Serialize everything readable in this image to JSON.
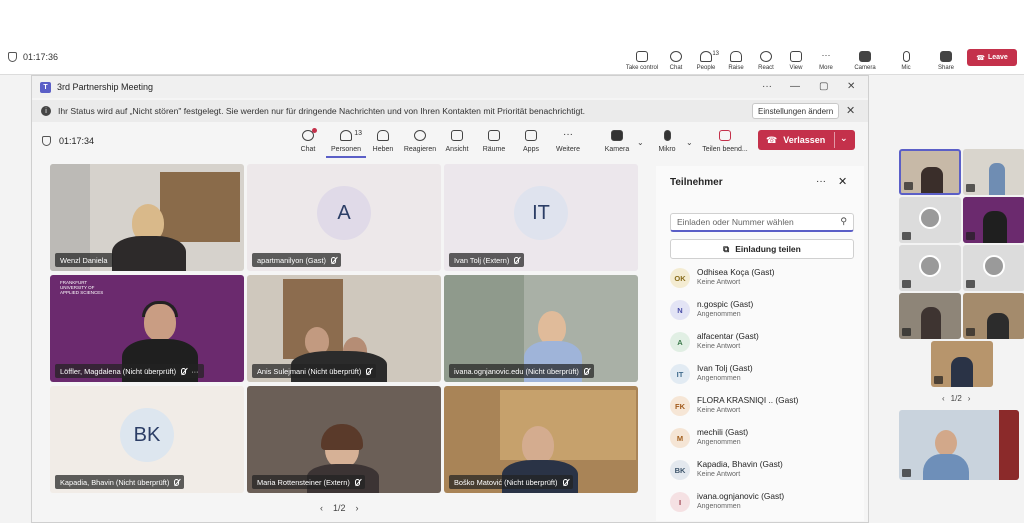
{
  "outer": {
    "timer": "01:17:36",
    "tools": [
      {
        "label": "Take control",
        "icon": "take-control-icon"
      },
      {
        "label": "Chat",
        "icon": "chat-icon"
      },
      {
        "label": "People",
        "icon": "people-icon",
        "count": "13"
      },
      {
        "label": "Raise",
        "icon": "raise-hand-icon"
      },
      {
        "label": "React",
        "icon": "react-icon"
      },
      {
        "label": "View",
        "icon": "view-icon"
      },
      {
        "label": "More",
        "icon": "more-icon"
      },
      {
        "label": "Camera",
        "icon": "camera-icon"
      },
      {
        "label": "Mic",
        "icon": "mic-icon"
      },
      {
        "label": "Share",
        "icon": "share-icon"
      }
    ],
    "leave_label": "Leave"
  },
  "window": {
    "title": "3rd Partnership Meeting",
    "more": "···",
    "minimize": "—",
    "maximize": "▢",
    "close": "✕"
  },
  "banner": {
    "message": "Ihr Status wird auf „Nicht stören\" festgelegt. Sie werden nur für dringende Nachrichten und von Ihren Kontakten mit Priorität benachrichtigt.",
    "settings_label": "Einstellungen ändern",
    "close": "✕"
  },
  "toolbar": {
    "timer": "01:17:34",
    "tools": [
      {
        "label": "Chat",
        "icon": "chat-icon"
      },
      {
        "label": "Personen",
        "icon": "people-icon",
        "count": "13"
      },
      {
        "label": "Heben",
        "icon": "raise-hand-icon"
      },
      {
        "label": "Reagieren",
        "icon": "react-icon"
      },
      {
        "label": "Ansicht",
        "icon": "view-icon"
      },
      {
        "label": "Räume",
        "icon": "rooms-icon"
      },
      {
        "label": "Apps",
        "icon": "apps-icon"
      },
      {
        "label": "Weitere",
        "icon": "more-icon"
      },
      {
        "label": "Kamera",
        "icon": "camera-icon"
      },
      {
        "label": "Mikro",
        "icon": "mic-icon"
      },
      {
        "label": "Teilen beend...",
        "icon": "stop-share-icon"
      }
    ],
    "leave_label": "Verlassen"
  },
  "tiles": [
    {
      "name": "Wenzl Daniela",
      "type": "video"
    },
    {
      "name": "apartmanilyon (Gast)",
      "type": "avatar",
      "initials": "A",
      "bg": "#ede8ea"
    },
    {
      "name": "Ivan Tolj (Extern)",
      "type": "avatar",
      "initials": "IT",
      "bg": "#ece7ec"
    },
    {
      "name": "Löffler, Magdalena (Nicht überprüft)",
      "type": "video",
      "more": "···"
    },
    {
      "name": "Anis Sulejmani (Nicht überprüft)",
      "type": "video"
    },
    {
      "name": "ivana.ognjanovic.edu (Nicht überprüft)",
      "type": "video"
    },
    {
      "name": "Kapadia, Bhavin (Nicht überprüft)",
      "type": "avatar",
      "initials": "BK",
      "bg": "#f1ece7"
    },
    {
      "name": "Maria Rottensteiner (Extern)",
      "type": "video"
    },
    {
      "name": "Boško Matović (Nicht überprüft)",
      "type": "video"
    }
  ],
  "logo_text": "FRANKFURT UNIVERSITY OF APPLIED SCIENCES",
  "pager": {
    "prev": "‹",
    "page": "1/2",
    "next": "›"
  },
  "panel": {
    "title": "Teilnehmer",
    "more": "···",
    "close": "✕",
    "invite_placeholder": "Einladen oder Nummer wählen",
    "share_label": "Einladung teilen",
    "participants": [
      {
        "initials": "OK",
        "name": "Odhisea Koça (Gast)",
        "status": "Keine Antwort",
        "bg": "#f4ecd2",
        "fg": "#8a6d1c"
      },
      {
        "initials": "N",
        "name": "n.gospic (Gast)",
        "status": "Angenommen",
        "bg": "#e3e4f5",
        "fg": "#4b4fa8"
      },
      {
        "initials": "A",
        "name": "alfacentar (Gast)",
        "status": "Keine Antwort",
        "bg": "#e1efe4",
        "fg": "#3c7a4b"
      },
      {
        "initials": "IT",
        "name": "Ivan Tolj (Gast)",
        "status": "Angenommen",
        "bg": "#e2ebf3",
        "fg": "#3f6a8c"
      },
      {
        "initials": "FK",
        "name": "FLORA KRASNIQI .. (Gast)",
        "status": "Keine Antwort",
        "bg": "#f6e6d6",
        "fg": "#a15a1c"
      },
      {
        "initials": "M",
        "name": "mechili (Gast)",
        "status": "Angenommen",
        "bg": "#f5e5d5",
        "fg": "#a35f1e"
      },
      {
        "initials": "BK",
        "name": "Kapadia, Bhavin (Gast)",
        "status": "Keine Antwort",
        "bg": "#e3e8ee",
        "fg": "#3f566c"
      },
      {
        "initials": "I",
        "name": "ivana.ognjanovic (Gast)",
        "status": "Angenommen",
        "bg": "#f5e1e3",
        "fg": "#9c3c4a"
      }
    ]
  },
  "strip_pager": {
    "prev": "‹",
    "page": "1/2",
    "next": "›"
  },
  "colors": {
    "accent": "#5b5fc7",
    "leave": "#c4314b"
  }
}
